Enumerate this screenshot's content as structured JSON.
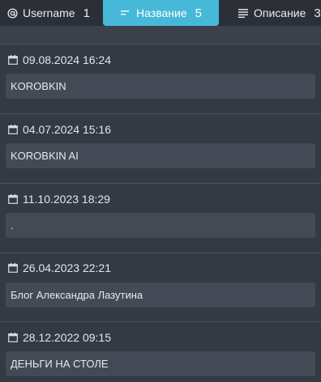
{
  "tabs": [
    {
      "label": "Username",
      "count": "1",
      "icon": "at-icon"
    },
    {
      "label": "Название",
      "count": "5",
      "icon": "short-lines-icon"
    },
    {
      "label": "Описание",
      "count": "3",
      "icon": "text-lines-icon"
    }
  ],
  "items": [
    {
      "date": "09.08.2024 16:24",
      "title": "KOROBKIN"
    },
    {
      "date": "04.07.2024 15:16",
      "title": "KOROBKIN AI"
    },
    {
      "date": "11.10.2023 18:29",
      "title": "."
    },
    {
      "date": "26.04.2023 22:21",
      "title": "Блог Александра Лазутина"
    },
    {
      "date": "28.12.2022 09:15",
      "title": "ДЕНЬГИ НА СТОЛЕ"
    }
  ],
  "colors": {
    "background": "#333a44",
    "active_tab": "#46b8d8",
    "field": "#434a55",
    "divider": "#4a5260"
  }
}
